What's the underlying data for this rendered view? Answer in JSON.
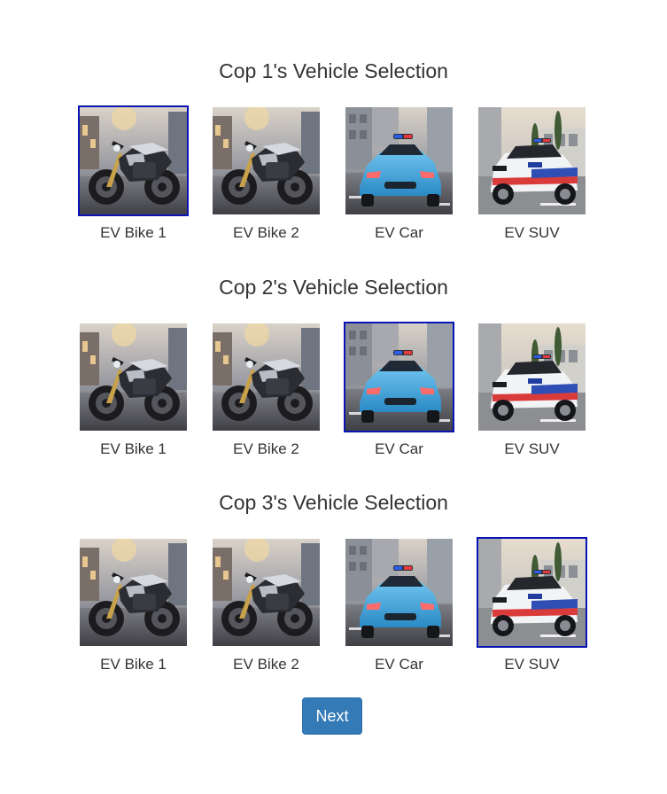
{
  "sections": [
    {
      "title": "Cop 1's Vehicle Selection",
      "selected_index": 0,
      "vehicles": [
        {
          "label": "EV Bike 1",
          "image": "ev-bike-photo",
          "selected": true
        },
        {
          "label": "EV Bike 2",
          "image": "ev-bike-photo",
          "selected": false
        },
        {
          "label": "EV Car",
          "image": "ev-car-photo",
          "selected": false
        },
        {
          "label": "EV SUV",
          "image": "ev-suv-photo",
          "selected": false
        }
      ]
    },
    {
      "title": "Cop 2's Vehicle Selection",
      "selected_index": 2,
      "vehicles": [
        {
          "label": "EV Bike 1",
          "image": "ev-bike-photo",
          "selected": false
        },
        {
          "label": "EV Bike 2",
          "image": "ev-bike-photo",
          "selected": false
        },
        {
          "label": "EV Car",
          "image": "ev-car-photo",
          "selected": true
        },
        {
          "label": "EV SUV",
          "image": "ev-suv-photo",
          "selected": false
        }
      ]
    },
    {
      "title": "Cop 3's Vehicle Selection",
      "selected_index": 3,
      "vehicles": [
        {
          "label": "EV Bike 1",
          "image": "ev-bike-photo",
          "selected": false
        },
        {
          "label": "EV Bike 2",
          "image": "ev-bike-photo",
          "selected": false
        },
        {
          "label": "EV Car",
          "image": "ev-car-photo",
          "selected": false
        },
        {
          "label": "EV SUV",
          "image": "ev-suv-photo",
          "selected": true
        }
      ]
    }
  ],
  "next_button": {
    "label": "Next"
  },
  "colors": {
    "selected_border": "#0a14b4",
    "button_bg": "#337ab7",
    "text": "#333333"
  }
}
